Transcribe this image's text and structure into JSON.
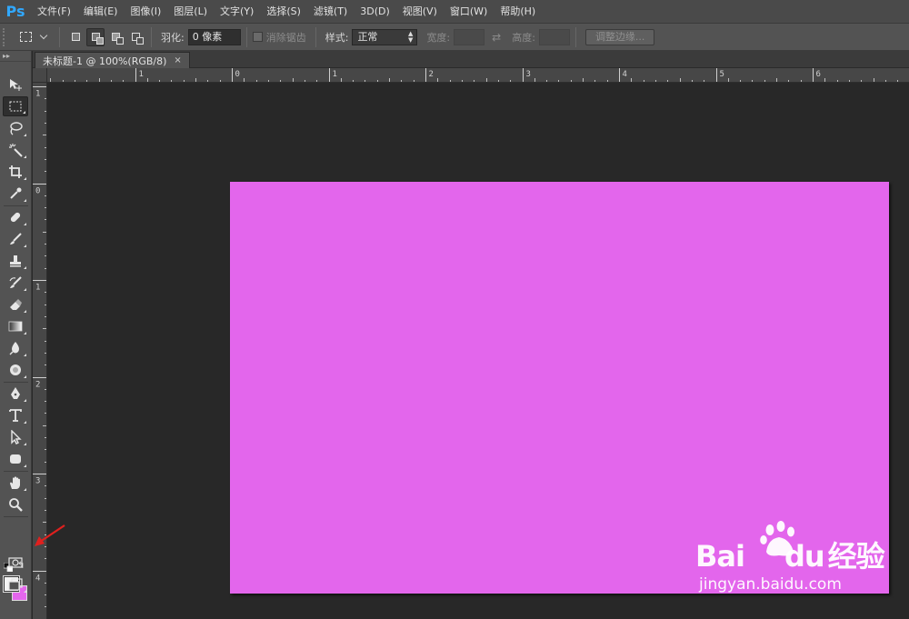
{
  "app": {
    "logo": "Ps"
  },
  "menu": [
    "文件(F)",
    "编辑(E)",
    "图像(I)",
    "图层(L)",
    "文字(Y)",
    "选择(S)",
    "滤镜(T)",
    "3D(D)",
    "视图(V)",
    "窗口(W)",
    "帮助(H)"
  ],
  "options": {
    "feather_label": "羽化:",
    "feather_value": "0 像素",
    "antialias_label": "消除锯齿",
    "style_label": "样式:",
    "style_value": "正常",
    "width_label": "宽度:",
    "width_value": "",
    "height_label": "高度:",
    "height_value": "",
    "refine_edge_label": "调整边缘..."
  },
  "document": {
    "tab_title": "未标题-1 @ 100%(RGB/8)",
    "close_glyph": "×"
  },
  "rulers": {
    "horizontal": [
      "1",
      "0",
      "1",
      "2",
      "3",
      "4",
      "5",
      "6"
    ],
    "vertical": [
      "1",
      "0",
      "1",
      "2",
      "3",
      "4"
    ]
  },
  "colors": {
    "canvas_fill": "#e366ec",
    "foreground": "#f4f4f4",
    "background": "#e366ec",
    "accent_logo": "#31a8ff",
    "annotation": "#e0201e"
  },
  "tools": [
    "move-icon",
    "rect-marquee-icon",
    "lasso-icon",
    "magic-wand-icon",
    "crop-icon",
    "eyedropper-icon",
    "healing-brush-icon",
    "brush-icon",
    "clone-stamp-icon",
    "history-brush-icon",
    "eraser-icon",
    "gradient-icon",
    "blur-icon",
    "dodge-icon",
    "pen-icon",
    "type-icon",
    "path-select-icon",
    "shape-icon",
    "hand-icon",
    "zoom-icon"
  ],
  "watermark": {
    "brand_latin": "Bai",
    "brand_latin2": "du",
    "brand_cn": "经验",
    "url": "jingyan.baidu.com"
  }
}
